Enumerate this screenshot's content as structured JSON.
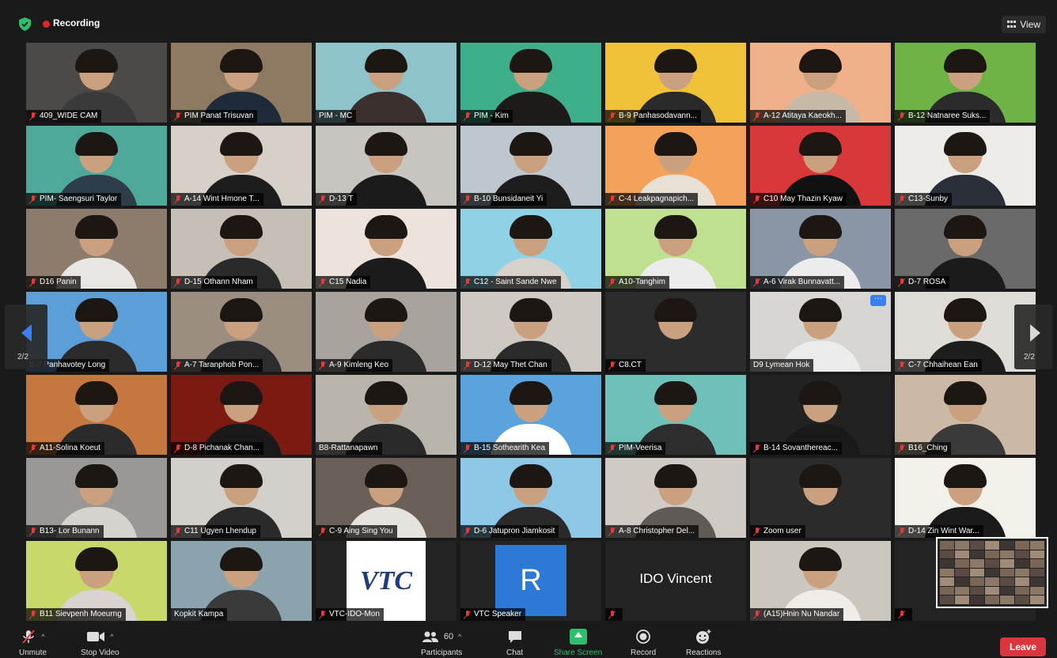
{
  "topbar": {
    "recording_label": "Recording",
    "view_label": "View"
  },
  "pagination": {
    "left": "2/2",
    "right": "2/2"
  },
  "tiles": [
    {
      "name": "409_WIDE CAM",
      "muted": true,
      "bg": "#4b4a48",
      "shirt": "#3a3a3a"
    },
    {
      "name": "PIM Panat Trisuvan",
      "muted": true,
      "bg": "#8e7a62",
      "shirt": "#1f2a3a"
    },
    {
      "name": "PIM - MC",
      "muted": false,
      "bg": "#8fc3cc",
      "shirt": "#3a2f2d"
    },
    {
      "name": "PIM - Kim",
      "muted": true,
      "bg": "#3fae8a",
      "shirt": "#1f1a1a"
    },
    {
      "name": "B-9 Panhasodavann...",
      "muted": true,
      "bg": "#f0c23a",
      "shirt": "#2a2a2a"
    },
    {
      "name": "A-12 Atitaya Kaeokh...",
      "muted": true,
      "bg": "#f0b08a",
      "shirt": "#c7b9a8"
    },
    {
      "name": "B-12 Natnaree Suks...",
      "muted": true,
      "bg": "#6fb347",
      "shirt": "#2b2b2b"
    },
    {
      "name": "PIM- Saengsuri Taylor",
      "muted": true,
      "bg": "#4fa99a",
      "shirt": "#2d3d4a"
    },
    {
      "name": "A-14 Wint Hmone T...",
      "muted": true,
      "bg": "#d7d0c8",
      "shirt": "#1d1d1d"
    },
    {
      "name": "D-13 T",
      "muted": true,
      "bg": "#c8c5c0",
      "shirt": "#1b1b1b"
    },
    {
      "name": "B-10 Bunsidaneit Yi",
      "muted": true,
      "bg": "#bcc7ce",
      "shirt": "#1d1d1d"
    },
    {
      "name": "C-4 Leakpagnapich...",
      "muted": true,
      "bg": "#f4a25a",
      "shirt": "#e8e0d4"
    },
    {
      "name": "C10 May Thazin Kyaw",
      "muted": true,
      "bg": "#d9383b",
      "shirt": "#111"
    },
    {
      "name": "C13-Sunby",
      "muted": true,
      "bg": "#ecebe8",
      "shirt": "#2a2f3a"
    },
    {
      "name": "D16 Panin",
      "muted": true,
      "bg": "#8d7b6c",
      "shirt": "#e8e6e3"
    },
    {
      "name": "D-15 Othann Nham",
      "muted": true,
      "bg": "#c5bfb6",
      "shirt": "#2a2a2a"
    },
    {
      "name": "C15 Nadia",
      "muted": true,
      "bg": "#ece4dc",
      "shirt": "#1b1b1b"
    },
    {
      "name": "C12 - Saint Sande Nwe",
      "muted": true,
      "bg": "#8fd2e6",
      "shirt": "#d6d1ca"
    },
    {
      "name": "A10-Tanghim",
      "muted": true,
      "bg": "#bfe08f",
      "shirt": "#ececec"
    },
    {
      "name": "A-6 Virak Bunnavatt...",
      "muted": true,
      "bg": "#8a96a6",
      "shirt": "#ececec"
    },
    {
      "name": "D-7 ROSA",
      "muted": true,
      "bg": "#6a6a6a",
      "shirt": "#1b1b1b"
    },
    {
      "name": "B-7 Panhavotey Long",
      "muted": false,
      "bg": "#5c9ed8",
      "shirt": "#2b2b2b"
    },
    {
      "name": "A-7 Taranphob Pon...",
      "muted": true,
      "bg": "#9b8e80",
      "shirt": "#2d2d2d"
    },
    {
      "name": "A-9 Kimleng Keo",
      "muted": true,
      "bg": "#a8a39c",
      "shirt": "#2b2b2b"
    },
    {
      "name": "D-12 May Thet Chan",
      "muted": true,
      "bg": "#cfc9c4",
      "shirt": "#2b2b2b"
    },
    {
      "name": "C8.CT",
      "muted": true,
      "bg": "#2c2c2c",
      "shirt": "#2c2c2c",
      "more": false
    },
    {
      "name": "D9 Lymean Hok",
      "muted": false,
      "bg": "#d8d6d2",
      "shirt": "#ececec",
      "more": true
    },
    {
      "name": "C-7 Chhaihean Ean",
      "muted": true,
      "bg": "#dfdcd8",
      "shirt": "#1d1d1d"
    },
    {
      "name": "A11-Solina Koeut",
      "muted": true,
      "bg": "#c6763f",
      "shirt": "#2b2b2b"
    },
    {
      "name": "D-8 Pichanak Chan...",
      "muted": true,
      "bg": "#7a1a12",
      "shirt": "#1a1a1a"
    },
    {
      "name": "B8-Rattanapawn",
      "muted": false,
      "bg": "#b9b4ac",
      "shirt": "#2a2a2a"
    },
    {
      "name": "B-15 Sothearith Kea",
      "muted": true,
      "bg": "#5aa3dc",
      "shirt": "#ffffff"
    },
    {
      "name": "PIM-Veerisa",
      "muted": true,
      "bg": "#6fc0b8",
      "shirt": "#2d2d2d"
    },
    {
      "name": "B-14 Sovanthereac...",
      "muted": true,
      "bg": "#222222",
      "shirt": "#1a1a1a"
    },
    {
      "name": "B16_Ching",
      "muted": true,
      "bg": "#cbb9a5",
      "shirt": "#3a3a3a"
    },
    {
      "name": "B13- Lor Bunann",
      "muted": true,
      "bg": "#9a9897",
      "shirt": "#d6d3cf"
    },
    {
      "name": "C11 Ugyen Lhendup",
      "muted": true,
      "bg": "#d3d0cb",
      "shirt": "#2a2a2a"
    },
    {
      "name": "C-9 Aing Sing You",
      "muted": true,
      "bg": "#6b6057",
      "shirt": "#e6e3df"
    },
    {
      "name": "D-6 Jatupron Jiamkosit",
      "muted": true,
      "bg": "#8ec7e5",
      "shirt": "#2a2a2a"
    },
    {
      "name": "A-8 Christopher Del...",
      "muted": true,
      "bg": "#cfcbc4",
      "shirt": "#5f5a55"
    },
    {
      "name": "Zoom user",
      "muted": true,
      "bg": "#2b2b2b",
      "shirt": "#2b2b2b"
    },
    {
      "name": "D-14 Zin Wint War...",
      "muted": true,
      "bg": "#f3efe9",
      "shirt": "#1b1b1b"
    },
    {
      "name": "B11 Sievpenh Moeurng",
      "muted": true,
      "bg": "#c8d86a",
      "shirt": "#d9d4cf"
    },
    {
      "name": "Kopkit Kampa",
      "muted": false,
      "bg": "#8ba3ad",
      "shirt": "#3a3a3a"
    },
    {
      "name": "VTC-IDO-Mon",
      "muted": true,
      "logo": "VTC"
    },
    {
      "name": "VTC Speaker",
      "muted": true,
      "avatar": "R"
    },
    {
      "name": "",
      "muted": true,
      "name_only": "IDO Vincent"
    },
    {
      "name": "(A15)Hnin Nu Nandar",
      "muted": true,
      "bg": "#cbc7bf",
      "shirt": "#f0ede9"
    },
    {
      "name": "",
      "muted": true,
      "empty": true
    }
  ],
  "toolbar": {
    "unmute": "Unmute",
    "stop_video": "Stop Video",
    "participants": "Participants",
    "participant_count": "60",
    "chat": "Chat",
    "share_screen": "Share Screen",
    "record": "Record",
    "reactions": "Reactions",
    "leave": "Leave"
  },
  "colors": {
    "accent": "#2d8cff",
    "share": "#2ebf6e",
    "leave": "#d9363e",
    "recording": "#e02828"
  }
}
